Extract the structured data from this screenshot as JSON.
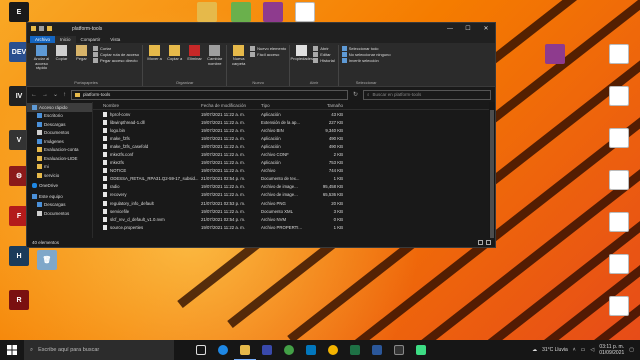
{
  "window": {
    "title": "platform-tools",
    "controls": [
      "—",
      "☐",
      "✕"
    ]
  },
  "ribbon": {
    "tabs": [
      "Archivo",
      "Inicio",
      "Compartir",
      "Vista"
    ],
    "groups": {
      "portapapeles": {
        "name": "Portapapeles",
        "anclar": "Anclar al acceso rápido",
        "copiar": "Copiar",
        "pegar": "Pegar",
        "cortar": "Cortar",
        "copiar_ruta": "Copiar ruta de acceso",
        "pegar_acceso": "Pegar acceso directo"
      },
      "organizar": {
        "name": "Organizar",
        "mover": "Mover a",
        "copiar": "Copiar a",
        "eliminar": "Eliminar",
        "cambiar": "Cambiar nombre"
      },
      "nuevo": {
        "name": "Nuevo",
        "nueva_carpeta": "Nueva carpeta",
        "nuevo_elemento": "Nuevo elemento",
        "facil_acceso": "Fácil acceso"
      },
      "abrir": {
        "name": "Abrir",
        "propiedades": "Propiedades",
        "abrir": "Abrir",
        "editar": "Editar",
        "historial": "Historial"
      },
      "seleccionar": {
        "name": "Seleccionar",
        "todo": "Seleccionar todo",
        "ninguno": "No seleccionar ninguno",
        "invertir": "Invertir selección"
      }
    }
  },
  "address": {
    "path": "platform-tools",
    "search_placeholder": "Buscar en platform-tools"
  },
  "navpane": {
    "items": [
      {
        "label": "Acceso rápido",
        "selected": true
      },
      {
        "label": "Escritorio"
      },
      {
        "label": "Descargas"
      },
      {
        "label": "Documentos"
      },
      {
        "label": "Imágenes"
      },
      {
        "label": "Evaluacion-conta"
      },
      {
        "label": "Evaluacion-LIDE"
      },
      {
        "label": "mi"
      },
      {
        "label": "servicio"
      },
      {
        "label": "OneDrive"
      },
      {
        "label": "Este equipo"
      },
      {
        "label": "Descargas"
      },
      {
        "label": "Documentos"
      }
    ]
  },
  "columns": {
    "name": "Nombre",
    "date": "Fecha de modificación",
    "type": "Tipo",
    "size": "Tamaño"
  },
  "files": [
    {
      "name": "hprof-conv",
      "date": "19/07/2021 11:22 a. m.",
      "type": "Aplicación",
      "size": "43 KB"
    },
    {
      "name": "libwinpthread-1.dll",
      "date": "19/07/2021 11:22 a. m.",
      "type": "Extensión de la ap...",
      "size": "227 KB"
    },
    {
      "name": "logo.bin",
      "date": "19/07/2021 11:22 a. m.",
      "type": "Archivo BIN",
      "size": "9,340 KB"
    },
    {
      "name": "make_f2fs",
      "date": "19/07/2021 11:22 a. m.",
      "type": "Aplicación",
      "size": "490 KB"
    },
    {
      "name": "make_f2fs_casefold",
      "date": "19/07/2021 11:22 a. m.",
      "type": "Aplicación",
      "size": "490 KB"
    },
    {
      "name": "mke2fs.conf",
      "date": "19/07/2021 11:22 a. m.",
      "type": "Archivo CONF",
      "size": "2 KB"
    },
    {
      "name": "mke2fs",
      "date": "19/07/2021 11:22 a. m.",
      "type": "Aplicación",
      "size": "753 KB"
    },
    {
      "name": "NOTICE",
      "date": "19/07/2021 11:22 a. m.",
      "type": "Archivo",
      "size": "744 KB"
    },
    {
      "name": "ODESSA_RETAIL_RPA31.Q2-59-17_subsid...",
      "date": "21/07/2021 02:54 p. m.",
      "type": "Documento de tex...",
      "size": "1 KB"
    },
    {
      "name": "radio",
      "date": "19/07/2021 11:22 a. m.",
      "type": "Archivo de image...",
      "size": "95,458 KB"
    },
    {
      "name": "recovery",
      "date": "19/07/2021 11:22 a. m.",
      "type": "Archivo de image...",
      "size": "65,536 KB"
    },
    {
      "name": "regulatory_info_default",
      "date": "21/07/2021 02:53 p. m.",
      "type": "Archivo PNG",
      "size": "20 KB"
    },
    {
      "name": "servicefile",
      "date": "19/07/2021 11:22 a. m.",
      "type": "Documento XML",
      "size": "3 KB"
    },
    {
      "name": "slcf_rev_d_default_v1.0.nvm",
      "date": "21/07/2021 02:54 p. m.",
      "type": "Archivo NVM",
      "size": "0 KB"
    },
    {
      "name": "source.properties",
      "date": "19/07/2021 11:22 a. m.",
      "type": "Archivo PROPERTI...",
      "size": "1 KB"
    }
  ],
  "status": {
    "count": "40 elementos"
  },
  "desktop_icons": [
    {
      "label": "EPIC GAMES",
      "color": "#1a1a1a"
    },
    {
      "label": "Dev-C++",
      "color": "#2a4f8f"
    },
    {
      "label": "Grand Theft Auto IV",
      "color": "#222222"
    },
    {
      "label": "Grand Theft Auto V",
      "color": "#333333"
    },
    {
      "label": "Gears 5",
      "color": "#8b1a1a"
    },
    {
      "label": "Forza Horizon 4",
      "color": "#b31b1b"
    },
    {
      "label": "Halo The Master Chief",
      "color": "#1b3b5a"
    },
    {
      "label": "Red Dead Redemption 2",
      "color": "#7a1010"
    },
    {
      "label": "Recycle bin",
      "color": "#7fa7c9"
    }
  ],
  "taskbar": {
    "search_placeholder": "Escribe aquí para buscar",
    "weather": "31°C Lluvia",
    "time": "03:11 p. m.",
    "date": "01/09/2021"
  },
  "colors": {
    "accent": "#1565c0",
    "window_bg": "#191919",
    "ribbon_bg": "#2b2b2b"
  }
}
